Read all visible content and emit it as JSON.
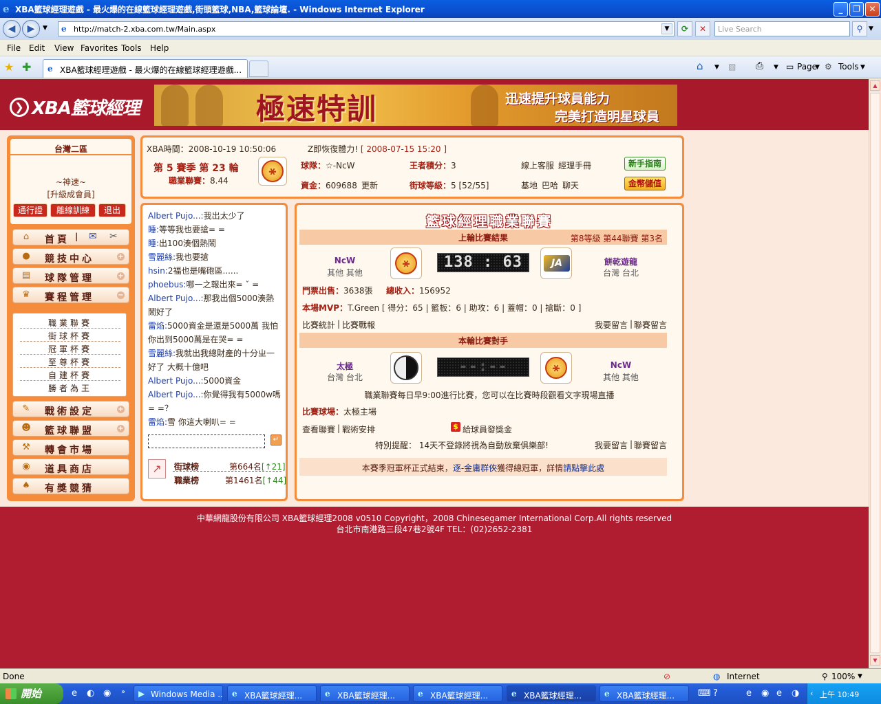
{
  "window": {
    "title": "XBA籃球經理遊戲 - 最火爆的在線籃球經理遊戲,街頭籃球,NBA,籃球論壇. - Windows Internet Explorer",
    "url": "http://match-2.xba.com.tw/Main.aspx",
    "search_placeholder": "Live Search",
    "tab_title": "XBA籃球經理遊戲 - 最火爆的在線籃球經理遊戲...",
    "menu": [
      "File",
      "Edit",
      "View",
      "Favorites",
      "Tools",
      "Help"
    ],
    "cmd_page": "Page",
    "cmd_tools": "Tools"
  },
  "site": {
    "logo_text": "XBA籃球經理",
    "banner_big": "極速特訓",
    "banner_line1": "迅速提升球員能力",
    "banner_line2": "完美打造明星球員"
  },
  "user": {
    "server": "台灣二區",
    "name": "~神速~",
    "rank": "[升級成會員]",
    "btn_pass": "通行證",
    "btn_offline": "離線訓練",
    "btn_exit": "退出"
  },
  "menu": {
    "home": "首頁",
    "compete": "競技中心",
    "team": "球隊管理",
    "schedule": "賽程管理",
    "sub": [
      "職業聯賽",
      "街球杯賽",
      "冠軍杯賽",
      "至尊杯賽",
      "自建杯賽",
      "勝者為王"
    ],
    "tactics": "戰術設定",
    "alliance": "籃球聯盟",
    "transfer": "轉會市場",
    "shop": "道具商店",
    "guess": "有獎競猜"
  },
  "info": {
    "time_label": "XBA時間：",
    "time_value": "2008-10-19 10:50:06",
    "recovery": "Z即恢復體力!",
    "recovery_time": "[ 2008-07-15 15:20 ]",
    "season": "第 5 賽季 第 23 輪",
    "league_label": "職業聯賽：",
    "league_value": "8.44",
    "team_label": "球隊：",
    "team_value": "☆-NcW",
    "king_label": "王者積分：",
    "king_value": "3",
    "service": "線上客服",
    "manual": "經理手冊",
    "guide_btn": "新手指南",
    "funds_label": "資金：",
    "funds_value": "609688",
    "update": "更新",
    "street_label": "街球等級：",
    "street_value": "5 [52/55]",
    "base": "基地",
    "bar": "巴哈",
    "chat": "聊天",
    "gold_btn": "金幣儲值"
  },
  "chat": {
    "messages": [
      {
        "who": "Albert Pujo...:",
        "text": "我出太少了"
      },
      {
        "who": "睡:",
        "text": "等等我也要搶= ="
      },
      {
        "who": "睡:",
        "text": "出100湊個熱鬧"
      },
      {
        "who": "雪麗絲:",
        "text": "我也要搶"
      },
      {
        "who": "hsin:",
        "text": "2福也是嘴砲區......"
      },
      {
        "who": "phoebus:",
        "text": "哪一之報出來= ˇ ="
      },
      {
        "who": "Albert Pujo...:",
        "text": "那我出個5000湊熱鬧好了"
      },
      {
        "who": "雷焰:",
        "text": "5000資金是還是5000萬 我怕你出到5000萬是在哭= ="
      },
      {
        "who": "雪麗絲:",
        "text": "我就出我總財產的十分ㄓ一好了 大概十億吧"
      },
      {
        "who": "Albert Pujo...:",
        "text": "5000資金"
      },
      {
        "who": "Albert Pujo...:",
        "text": "你覺得我有5000w嗎= =？"
      },
      {
        "who": "雷焰:",
        "text": "雪 你這大喇叭= ="
      }
    ],
    "street_rank_label": "街球榜",
    "street_rank": "第664名",
    "street_change": "[↑21]",
    "pro_rank_label": "職業榜",
    "pro_rank": "第1461名",
    "pro_change": "[↑44]"
  },
  "league": {
    "title": "籃球經理職業聯賽",
    "last_round": "上輪比賽結果",
    "last_round_rank": "第8等級 第44聯賽 第3名",
    "home_team": "NcW",
    "home_loc": "其他 其他",
    "score": "138 : 63",
    "away_team": "餅乾遊龍",
    "away_loc": "台灣 台北",
    "tickets_label": "門票出售：",
    "tickets_value": "3638張",
    "income_label": "總收入：",
    "income_value": "156952",
    "mvp_label": "本場MVP：",
    "mvp_value": "T.Green [ 得分：65 | 籃板：6 | 助攻：6 | 蓋帽：0 | 搶斷：0 ]",
    "stats_link": "比賽統計",
    "report_link": "比賽戰報",
    "msg_link": "我要留言",
    "league_msg_link": "聯賽留言",
    "next_round": "本輪比賽對手",
    "opp_team": "太極",
    "opp_loc": "台灣 台北",
    "next_score": "--:--",
    "my_team": "NcW",
    "my_loc": "其他 其他",
    "schedule_note": "職業聯賽每日早9:00進行比賽，您可以在比賽時段觀看文字現場直播",
    "venue_label": "比賽球場：",
    "venue_value": "太極主場",
    "view_league": "查看聯賽",
    "tactics_link": "戰術安排",
    "bonus_link": "給球員發獎金",
    "reminder": "特別提醒：  14天不登錄將視為自動放棄俱樂部!",
    "notice_a": "本賽季冠軍杯正式結束，",
    "notice_b": "逐-金庸群俠",
    "notice_c": "獲得總冠軍，詳情",
    "notice_d": "請點擊此處"
  },
  "footer": {
    "line1": "中華網龍股份有限公司  XBA籃球經理2008 v0510    Copyright，2008 Chinesegamer International Corp.All rights reserved",
    "line2": "台北市南港路三段47巷2號4F TEL：(02)2652-2381"
  },
  "status": {
    "done": "Done",
    "zone": "Internet",
    "zoom": "100%"
  },
  "taskbar": {
    "start": "開始",
    "items": [
      "Windows Media ...",
      "XBA籃球經理...",
      "XBA籃球經理...",
      "XBA籃球經理...",
      "XBA籃球經理...",
      "XBA籃球經理..."
    ],
    "clock": "上午 10:49"
  }
}
